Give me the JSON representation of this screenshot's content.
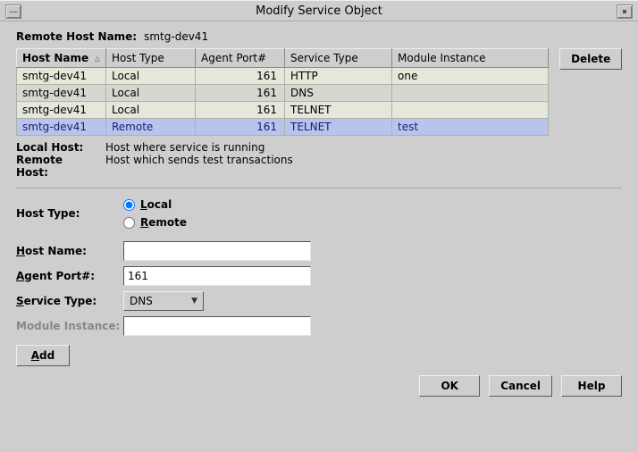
{
  "window": {
    "title": "Modify Service Object"
  },
  "header": {
    "remote_host_label": "Remote Host Name:",
    "remote_host_value": "smtg-dev41"
  },
  "table": {
    "columns": {
      "host_name": "Host Name",
      "host_type": "Host Type",
      "agent_port": "Agent Port#",
      "service_type": "Service Type",
      "module_instance": "Module Instance"
    },
    "rows": [
      {
        "host_name": "smtg-dev41",
        "host_type": "Local",
        "agent_port": "161",
        "service_type": "HTTP",
        "module_instance": "one"
      },
      {
        "host_name": "smtg-dev41",
        "host_type": "Local",
        "agent_port": "161",
        "service_type": "DNS",
        "module_instance": ""
      },
      {
        "host_name": "smtg-dev41",
        "host_type": "Local",
        "agent_port": "161",
        "service_type": "TELNET",
        "module_instance": ""
      },
      {
        "host_name": "smtg-dev41",
        "host_type": "Remote",
        "agent_port": "161",
        "service_type": "TELNET",
        "module_instance": "test"
      }
    ],
    "selected_index": 3
  },
  "buttons": {
    "delete": "Delete",
    "add": "Add",
    "ok": "OK",
    "cancel": "Cancel",
    "help": "Help"
  },
  "legend": {
    "local_host_label": "Local Host:",
    "local_host_desc": "Host where service is running",
    "remote_host_label": "Remote Host:",
    "remote_host_desc": "Host which sends test transactions"
  },
  "form": {
    "host_type_label": "Host Type:",
    "radio_local": "Local",
    "radio_remote": "Remote",
    "host_type_value": "Local",
    "host_name_label": "Host Name:",
    "host_name_value": "",
    "agent_port_label": "Agent Port#:",
    "agent_port_value": "161",
    "service_type_label": "Service Type:",
    "service_type_value": "DNS",
    "module_instance_label": "Module Instance:",
    "module_instance_value": ""
  }
}
